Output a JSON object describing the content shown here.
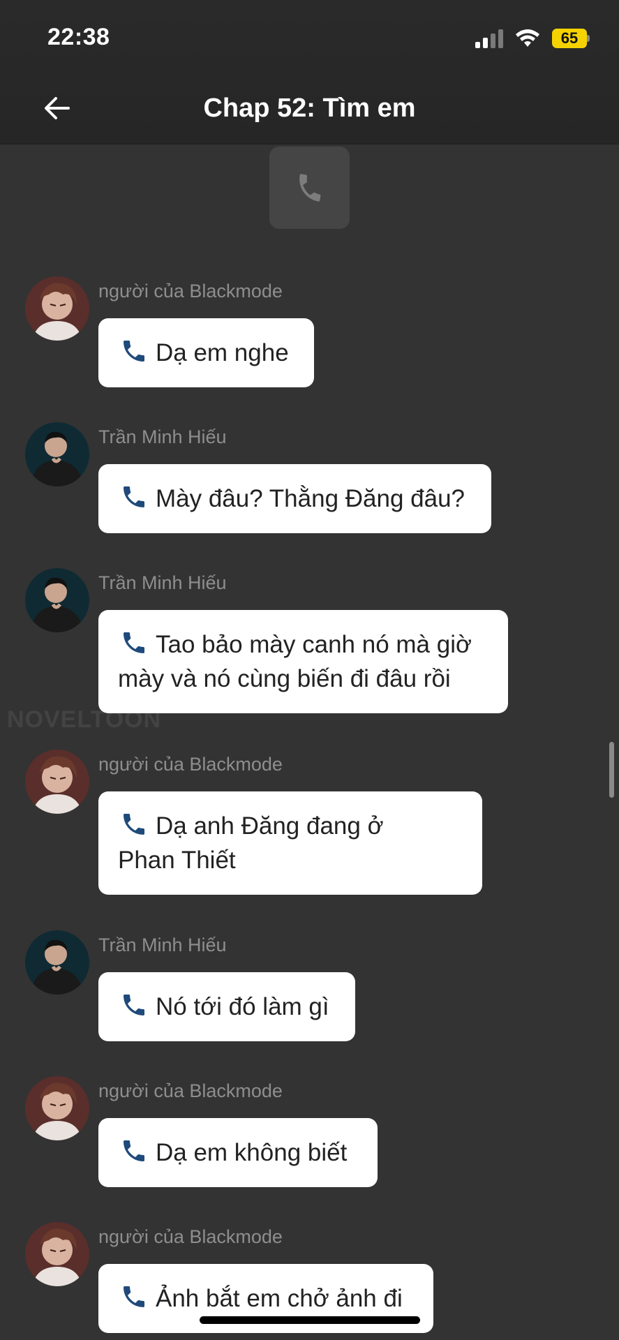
{
  "status_bar": {
    "time": "22:38",
    "battery": "65"
  },
  "header": {
    "title": "Chap 52: Tìm em"
  },
  "watermark": "NOVELTOON",
  "messages": [
    {
      "sender": "người của Blackmode",
      "text": "Dạ em nghe"
    },
    {
      "sender": "Trần Minh Hiếu",
      "text": "Mày đâu? Thằng Đăng đâu?"
    },
    {
      "sender": "Trần Minh Hiếu",
      "line1": "Tao bảo mày canh nó mà giờ",
      "line2": "mày và nó cùng biến đi đâu rồi"
    },
    {
      "sender": "người của Blackmode",
      "line1": "Dạ anh Đăng đang ở",
      "line2": "Phan Thiết"
    },
    {
      "sender": "Trần Minh Hiếu",
      "text": "Nó tới đó làm gì"
    },
    {
      "sender": "người của Blackmode",
      "text": "Dạ em không biết"
    },
    {
      "sender": "người của Blackmode",
      "text": "Ảnh bắt em chở ảnh đi"
    }
  ],
  "colors": {
    "background": "#333333",
    "bubble": "#ffffff",
    "sender_text": "#8e8e8e",
    "battery": "#f5d300",
    "phone_icon": "#1f4a7a"
  }
}
